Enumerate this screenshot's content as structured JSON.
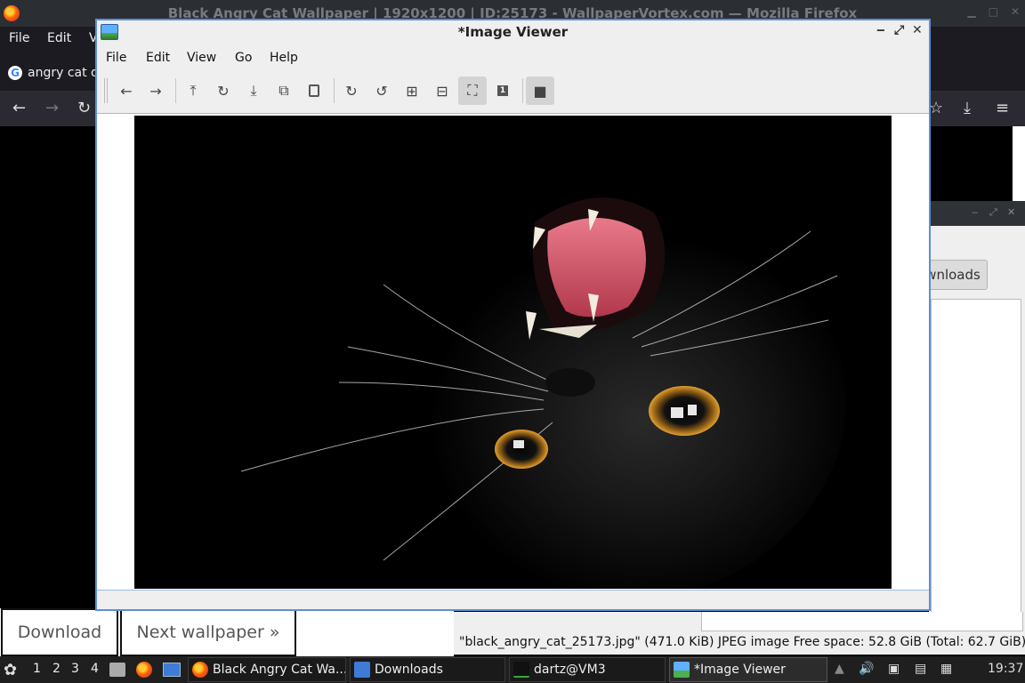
{
  "firefox": {
    "window_title": "Black Angry Cat Wallpaper | 1920x1200 | ID:25173 - WallpaperVortex.com — Mozilla Firefox",
    "menu": [
      "File",
      "Edit",
      "V"
    ],
    "tab_label": "angry cat d",
    "nav_icons": [
      "back-icon",
      "forward-icon",
      "reload-icon",
      "bookmark-star-icon",
      "download-icon",
      "menu-icon"
    ],
    "download_button": "Download",
    "next_button": "Next wallpaper »"
  },
  "downloads_window": {
    "button_label": "ownloads",
    "status_text": "\"black_angry_cat_25173.jpg\" (471.0 KiB) JPEG image    Free space: 52.8 GiB (Total: 62.7 GiB)"
  },
  "image_viewer": {
    "title": "*Image Viewer",
    "menu": [
      "File",
      "Edit",
      "View",
      "Go",
      "Help"
    ],
    "toolbar": [
      {
        "name": "previous-icon",
        "glyph": "←"
      },
      {
        "name": "next-icon",
        "glyph": "→"
      },
      {
        "name": "open-icon",
        "glyph": "⤒"
      },
      {
        "name": "reload-icon",
        "glyph": "↻"
      },
      {
        "name": "save-icon",
        "glyph": "⤓"
      },
      {
        "name": "copy-icon",
        "glyph": "⧉"
      },
      {
        "name": "paste-icon",
        "glyph": "📋"
      },
      {
        "name": "rotate-clockwise-icon",
        "glyph": "↻"
      },
      {
        "name": "rotate-counterclockwise-icon",
        "glyph": "↺"
      },
      {
        "name": "zoom-in-icon",
        "glyph": "⊞"
      },
      {
        "name": "zoom-out-icon",
        "glyph": "⊟"
      },
      {
        "name": "zoom-fit-icon",
        "glyph": "⛶"
      },
      {
        "name": "zoom-original-icon",
        "glyph": "1"
      },
      {
        "name": "fullscreen-icon",
        "glyph": "■"
      }
    ],
    "window_controls": [
      "minimize-icon",
      "maximize-icon",
      "close-icon"
    ]
  },
  "taskbar": {
    "workspaces": [
      "1",
      "2",
      "3",
      "4"
    ],
    "tasks": [
      {
        "label": "Black Angry Cat Wa...",
        "icon": "firefox-icon"
      },
      {
        "label": "Downloads",
        "icon": "folder-icon"
      },
      {
        "label": "dartz@VM3",
        "icon": "terminal-icon"
      },
      {
        "label": "*Image Viewer",
        "icon": "image-viewer-icon"
      }
    ],
    "clock": "19:37"
  }
}
